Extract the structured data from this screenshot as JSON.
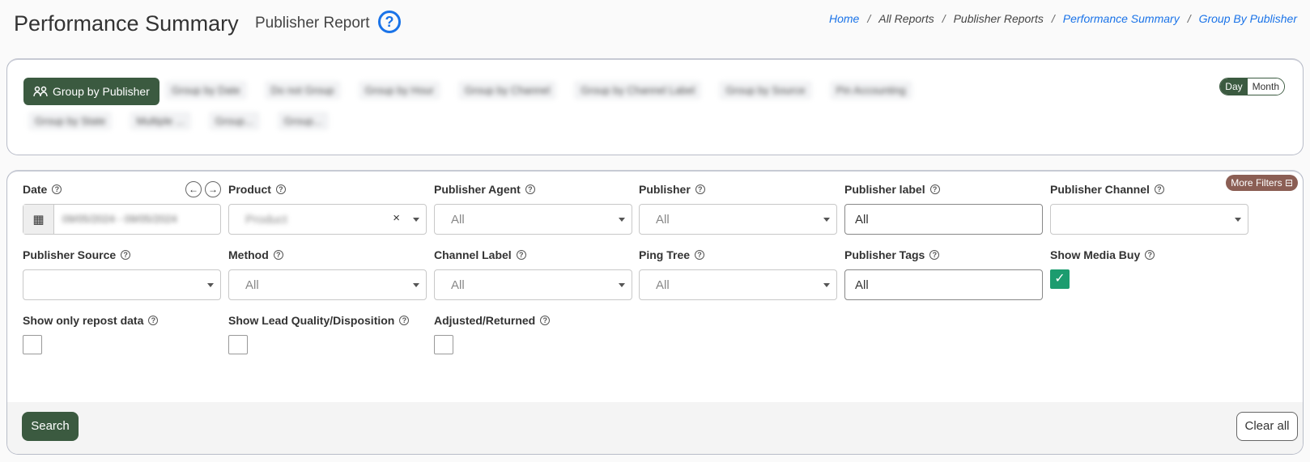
{
  "header": {
    "title": "Performance Summary",
    "subtitle": "Publisher Report",
    "help_glyph": "?"
  },
  "breadcrumb": [
    {
      "label": "Home",
      "link": true
    },
    {
      "label": "All Reports",
      "link": false
    },
    {
      "label": "Publisher Reports",
      "link": false
    },
    {
      "label": "Performance Summary",
      "link": true
    },
    {
      "label": "Group By Publisher",
      "link": true
    }
  ],
  "grouping": {
    "active_label": "Group by Publisher",
    "blurred_row1": [
      "Group by Date",
      "Do not Group",
      "Group by Hour",
      "Group by Channel",
      "Group by Channel Label",
      "Group by Source",
      "Pin Accounting"
    ],
    "blurred_row2": [
      "Group by State",
      "Multiple ...",
      "Group...",
      "Group..."
    ],
    "toggle_day": "Day",
    "toggle_month": "Month"
  },
  "filters": {
    "more_filters": "More Filters",
    "date": {
      "label": "Date",
      "value": "09/05/2024 - 09/05/2024"
    },
    "product": {
      "label": "Product",
      "value": "Product",
      "clear": "×"
    },
    "publisher_agent": {
      "label": "Publisher Agent",
      "value": "All"
    },
    "publisher": {
      "label": "Publisher",
      "value": "All"
    },
    "publisher_label": {
      "label": "Publisher label",
      "value": "All"
    },
    "publisher_channel": {
      "label": "Publisher Channel",
      "value": ""
    },
    "publisher_source": {
      "label": "Publisher Source",
      "value": ""
    },
    "method": {
      "label": "Method",
      "value": "All"
    },
    "channel_label": {
      "label": "Channel Label",
      "value": "All"
    },
    "ping_tree": {
      "label": "Ping Tree",
      "value": "All"
    },
    "publisher_tags": {
      "label": "Publisher Tags",
      "value": "All"
    },
    "show_media_buy": {
      "label": "Show Media Buy",
      "checked": true
    },
    "show_repost": {
      "label": "Show only repost data",
      "checked": false
    },
    "show_lead_quality": {
      "label": "Show Lead Quality/Disposition",
      "checked": false
    },
    "adjusted_returned": {
      "label": "Adjusted/Returned",
      "checked": false
    }
  },
  "footer": {
    "search_label": "Search",
    "clear_label": "Clear all"
  },
  "colors": {
    "primary": "#3b5a40",
    "accent": "#1a73e8",
    "check": "#1c9c6f",
    "more_filters": "#8b5e54"
  }
}
